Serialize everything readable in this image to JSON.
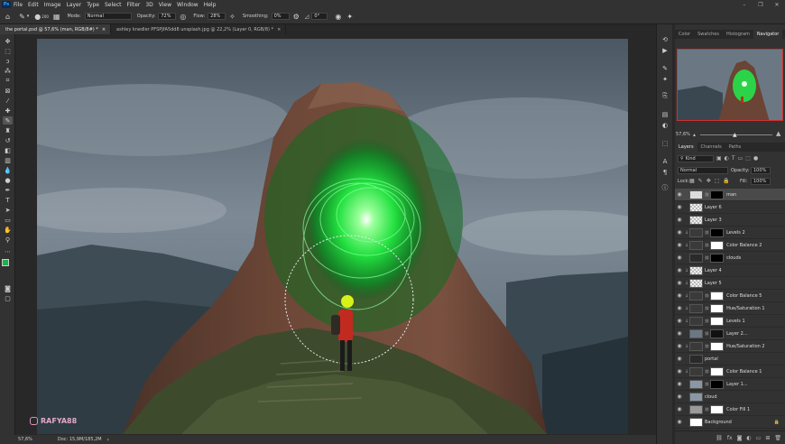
{
  "menubar": {
    "items": [
      "File",
      "Edit",
      "Image",
      "Layer",
      "Type",
      "Select",
      "Filter",
      "3D",
      "View",
      "Window",
      "Help"
    ],
    "window_controls": [
      "–",
      "❐",
      "✕"
    ]
  },
  "options": {
    "mode_label": "Mode:",
    "mode_value": "Normal",
    "opacity_label": "Opacity:",
    "opacity_value": "72%",
    "flow_label": "Flow:",
    "flow_value": "28%",
    "smoothing_label": "Smoothing:",
    "smoothing_value": "0%",
    "angle_value": "0°",
    "brush_size": "200"
  },
  "tabs": [
    {
      "label": "the portal.psd @ 57,6% (man, RGB/8#) *",
      "close": "×"
    },
    {
      "label": "ashley knedler PFSPJfA5dd8 unsplash.jpg @ 22,2% (Layer 0, RGB/8) *",
      "close": "×"
    }
  ],
  "status": {
    "zoom": "57,6%",
    "doc": "Doc: 15,9M/185,2M",
    "arrow": "›"
  },
  "watermark": "RAFYA88",
  "panels": {
    "top_tabs": [
      "Color",
      "Swatches",
      "Histogram",
      "Navigator"
    ],
    "top_active": "Navigator",
    "nav_zoom": "57,6%",
    "layer_tabs": [
      "Layers",
      "Channels",
      "Paths"
    ],
    "layer_active": "Layers",
    "kind_label": "Kind",
    "blend_mode": "Normal",
    "opacity_label": "Opacity:",
    "opacity_value": "100%",
    "lock_label": "Lock:",
    "fill_label": "Fill:",
    "fill_value": "100%"
  },
  "layers": [
    {
      "name": "man",
      "selected": true,
      "thumb": "person",
      "mask": "black"
    },
    {
      "name": "Layer 6",
      "thumb": "transparent"
    },
    {
      "name": "Layer 3",
      "thumb": "transparent"
    },
    {
      "name": "Levels 2",
      "thumb": "adj",
      "mask": "black",
      "clip": true
    },
    {
      "name": "Color Balance 2",
      "thumb": "adj",
      "mask": "white",
      "clip": true
    },
    {
      "name": "clouds",
      "thumb": "dark",
      "mask": "black"
    },
    {
      "name": "Layer 4",
      "thumb": "transparent",
      "clip": true
    },
    {
      "name": "Layer 5",
      "thumb": "transparent",
      "clip": true
    },
    {
      "name": "Color Balance 5",
      "thumb": "adj",
      "mask": "white",
      "clip": true
    },
    {
      "name": "Hue/Saturation 1",
      "thumb": "adj",
      "mask": "white",
      "clip": true
    },
    {
      "name": "Levels 1",
      "thumb": "adj",
      "mask": "white",
      "clip": true
    },
    {
      "name": "Layer 2...",
      "thumb": "photo",
      "mask": "shape"
    },
    {
      "name": "Hue/Saturation 2",
      "thumb": "adj",
      "mask": "white",
      "clip": true
    },
    {
      "name": "portal",
      "thumb": "dark"
    },
    {
      "name": "Color Balance 1",
      "thumb": "adj",
      "mask": "white",
      "clip": true
    },
    {
      "name": "Layer 1...",
      "thumb": "sky",
      "mask": "black"
    },
    {
      "name": "cloud",
      "thumb": "sky"
    },
    {
      "name": "Color Fill 1",
      "thumb": "fill",
      "mask": "white"
    },
    {
      "name": "Background",
      "thumb": "white"
    }
  ],
  "colors": {
    "glow": "#25e34a",
    "sky": "#5d6c78",
    "rock": "#6a4434",
    "foreground": "#1fb04a"
  }
}
